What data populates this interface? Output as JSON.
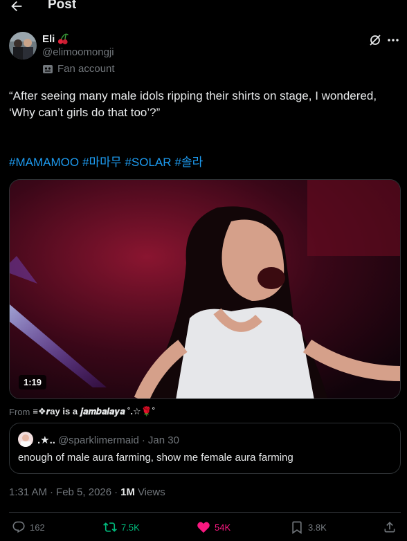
{
  "header": {
    "title": "Post"
  },
  "author": {
    "display_name": "Eli",
    "handle": "@elimoomongji",
    "badge_label": "Fan account"
  },
  "tweet": {
    "text_line1": "“After seeing many male idols ripping their shirts on stage, I wondered,",
    "text_line2": "‘Why can’t girls do that too’?”",
    "hashtags": [
      "#MAMAMOO",
      "#마마무",
      "#SOLAR",
      "#솔라"
    ]
  },
  "media": {
    "duration": "1:19"
  },
  "from": {
    "label": "From",
    "name": "≡❖𝒓ay is a 𝒋𝒂𝒎𝒃𝒂𝒍𝒂𝒚𝒂 ˚.☆🌹˚"
  },
  "quote": {
    "name": ".★..",
    "handle": "@sparklimermaid",
    "separator": "·",
    "date": "Jan 30",
    "text": "enough of male aura farming, show me female aura farming"
  },
  "meta": {
    "time": "1:31 AM",
    "separator1": "·",
    "date": "Feb 5, 2026",
    "separator2": "·",
    "views_count": "1M",
    "views_label": "Views"
  },
  "actions": {
    "replies": "162",
    "reposts": "7.5K",
    "likes": "54K",
    "bookmarks": "3.8K"
  },
  "colors": {
    "accent": "#1d9bf0",
    "repost": "#00ba7c",
    "like": "#f91880",
    "muted": "#71767b"
  },
  "icons": [
    "back-arrow-icon",
    "cherry-icon",
    "fan-account-icon",
    "grok-icon",
    "more-icon",
    "reply-icon",
    "repost-icon",
    "like-icon",
    "bookmark-icon",
    "share-icon"
  ]
}
